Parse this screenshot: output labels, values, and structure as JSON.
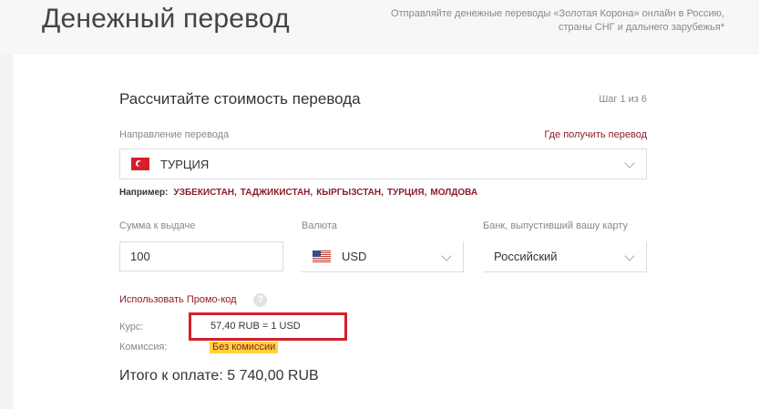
{
  "header": {
    "title": "Денежный перевод",
    "note": "Отправляйте денежные переводы «Золотая Корона» онлайн в Россию, страны СНГ и дальнего зарубежья*"
  },
  "form": {
    "title": "Рассчитайте стоимость перевода",
    "step": "Шаг 1 из 6",
    "direction_label": "Направление перевода",
    "where_to_receive_link": "Где получить перевод",
    "country_selected": "ТУРЦИЯ",
    "country_flag_icon": "turkey-flag-icon",
    "examples_label": "Например:",
    "examples": [
      "УЗБЕКИСТАН,",
      "ТАДЖИКИСТАН,",
      "КЫРГЫЗСТАН,",
      "ТУРЦИЯ,",
      "МОЛДОВА"
    ],
    "amount_label": "Сумма к выдаче",
    "amount_value": "100",
    "currency_label": "Валюта",
    "currency_value": "USD",
    "currency_flag_icon": "usa-flag-icon",
    "bank_label": "Банк, выпустивший вашу карту",
    "bank_value": "Российский",
    "promo_link": "Использовать Промо-код",
    "help_icon": "?",
    "rate_label": "Курс:",
    "rate_value": "57,40 RUB = 1 USD",
    "commission_label": "Комиссия:",
    "commission_value": "Без комиссии",
    "total": "Итого к оплате: 5 740,00 RUB"
  },
  "colors": {
    "accent_red": "#8b1d2b",
    "highlight_yellow": "#ffd33d",
    "annotation_red": "#d4202c"
  }
}
